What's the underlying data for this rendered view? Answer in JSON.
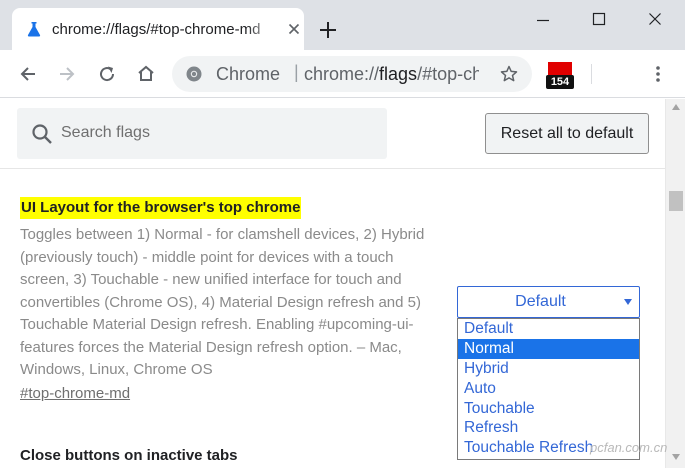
{
  "tab": {
    "title": "chrome://flags/#top-chrome-md",
    "favicon": "flask-icon"
  },
  "window_controls": [
    "minimize-icon",
    "maximize-icon",
    "close-icon"
  ],
  "toolbar": {
    "omnibox_chip": "Chrome",
    "url_scheme": "chrome://",
    "url_host": "flags",
    "url_rest": "/#top-chrome-md",
    "extension_badge": "154"
  },
  "search": {
    "placeholder": "Search flags"
  },
  "reset_button": "Reset all to default",
  "flag": {
    "title": "UI Layout for the browser's top chrome",
    "description": "Toggles between 1) Normal - for clamshell devices, 2) Hybrid (previously touch) - middle point for devices with a touch screen, 3) Touchable - new unified interface for touch and convertibles (Chrome OS), 4) Material Design refresh and 5) Touchable Material Design refresh. Enabling #upcoming-ui-features forces the Material Design refresh option. – Mac, Windows, Linux, Chrome OS",
    "link": "#top-chrome-md",
    "select_value": "Default",
    "options": [
      {
        "label": "Default",
        "selected": false
      },
      {
        "label": "Normal",
        "selected": true
      },
      {
        "label": "Hybrid",
        "selected": false
      },
      {
        "label": "Auto",
        "selected": false
      },
      {
        "label": "Touchable",
        "selected": false
      },
      {
        "label": "Refresh",
        "selected": false
      },
      {
        "label": "Touchable Refresh",
        "selected": false
      }
    ]
  },
  "next_flag": {
    "title": "Close buttons on inactive tabs"
  },
  "watermark": "pcfan.com.cn",
  "colors": {
    "highlight": "#ffff00",
    "accent": "#3367d6",
    "selected_option": "#1a73e8"
  }
}
